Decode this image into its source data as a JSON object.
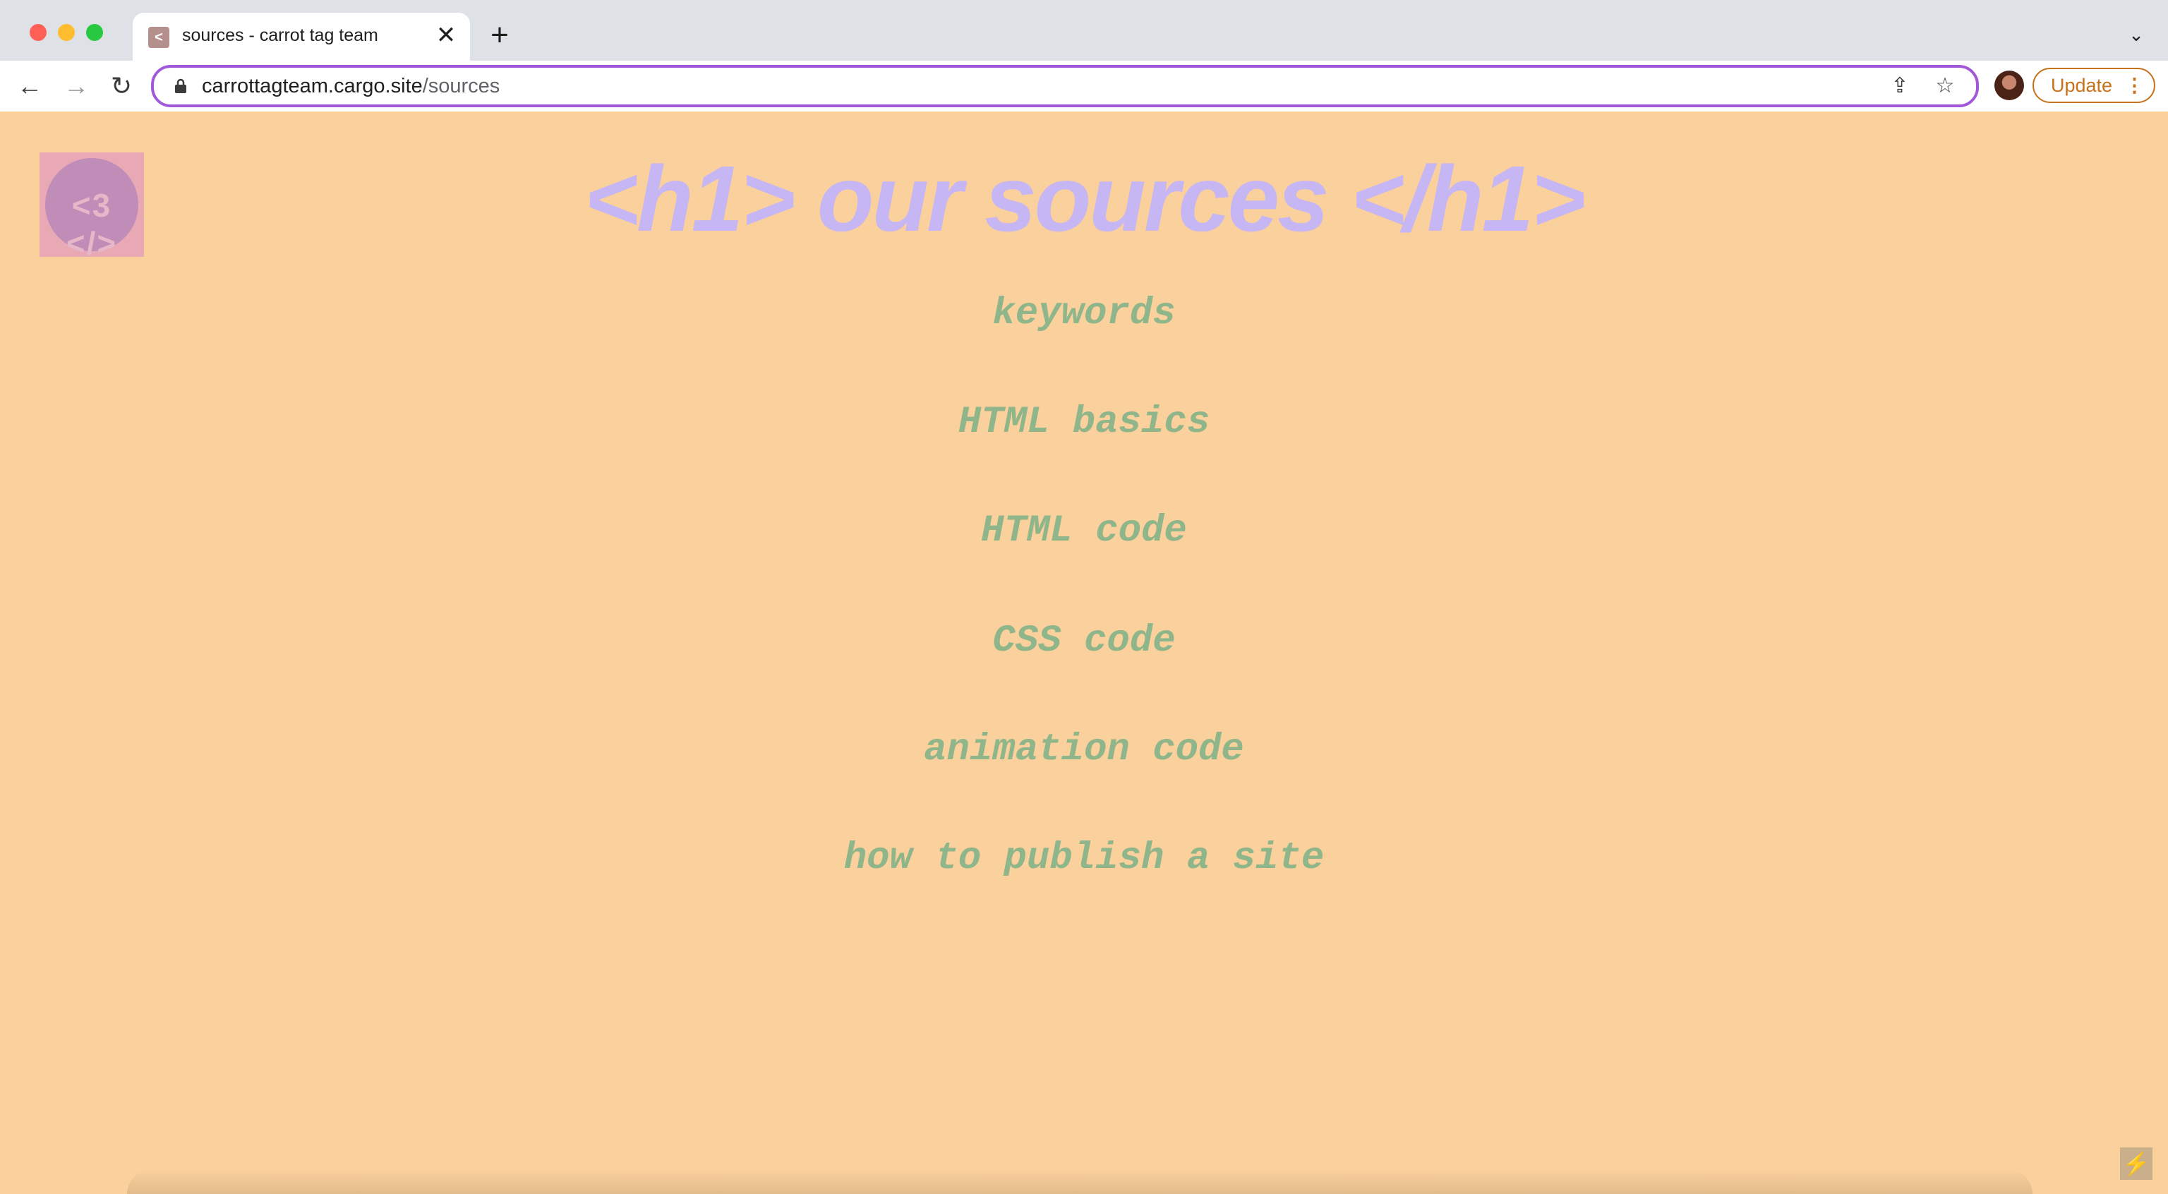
{
  "browser": {
    "tab_title": "sources - carrot tag team",
    "tab_close": "✕",
    "new_tab": "+",
    "url_host": "carrottagteam.cargo.site",
    "url_path": "/sources",
    "update_label": "Update"
  },
  "page": {
    "logo_text": "<3 </>",
    "heading": "<h1> our sources </h1>",
    "links": [
      "keywords",
      "HTML basics",
      "HTML code",
      "CSS code",
      "animation code",
      "how to publish a site"
    ]
  },
  "colors": {
    "background": "#fad09c",
    "heading": "#c7b6f4",
    "links": "#8fb58a",
    "omnibox_focus": "#a259d9",
    "update_accent": "#c7711a"
  },
  "icons": [
    "back-icon",
    "forward-icon",
    "reload-icon",
    "lock-icon",
    "share-icon",
    "star-icon",
    "menu-dots-icon",
    "bolt-icon"
  ]
}
